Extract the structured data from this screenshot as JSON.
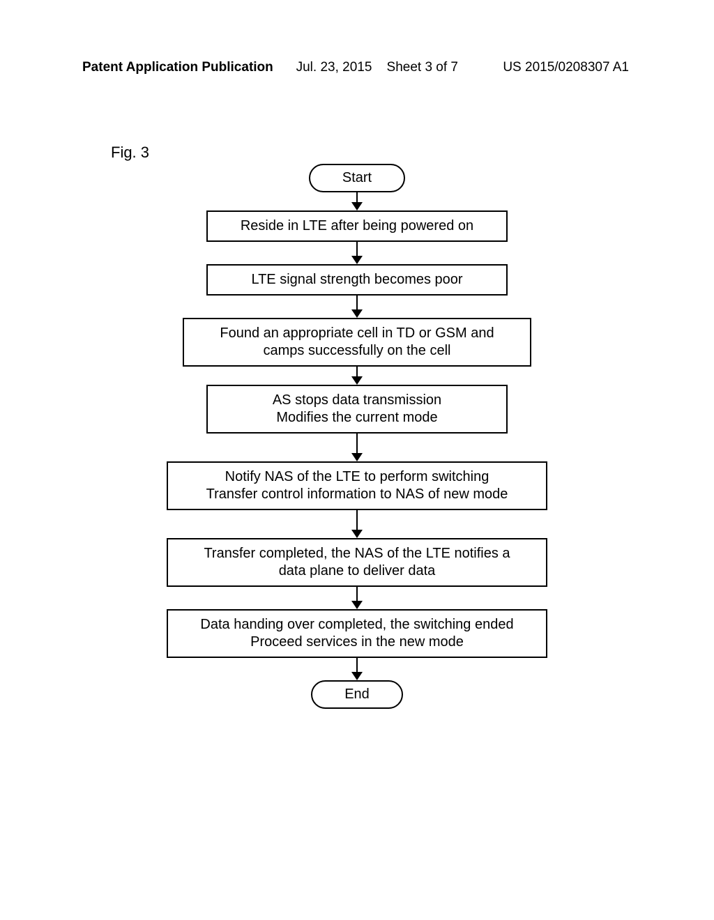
{
  "header": {
    "left": "Patent Application Publication",
    "mid_date": "Jul. 23, 2015",
    "mid_sheet": "Sheet 3 of 7",
    "pubno": "US 2015/0208307 A1"
  },
  "figure": {
    "label": "Fig. 3",
    "start": "Start",
    "end": "End",
    "steps": [
      "Reside in LTE after being powered on",
      "LTE signal strength becomes poor",
      "Found an appropriate cell in TD or GSM and\ncamps successfully on the cell",
      "AS stops data transmission\nModifies the current mode",
      "Notify NAS of the LTE to perform switching\nTransfer control information to NAS of new mode",
      "Transfer completed, the NAS of the LTE notifies a\ndata plane to deliver data",
      "Data handing over completed, the switching ended\nProceed services in the new mode"
    ]
  }
}
